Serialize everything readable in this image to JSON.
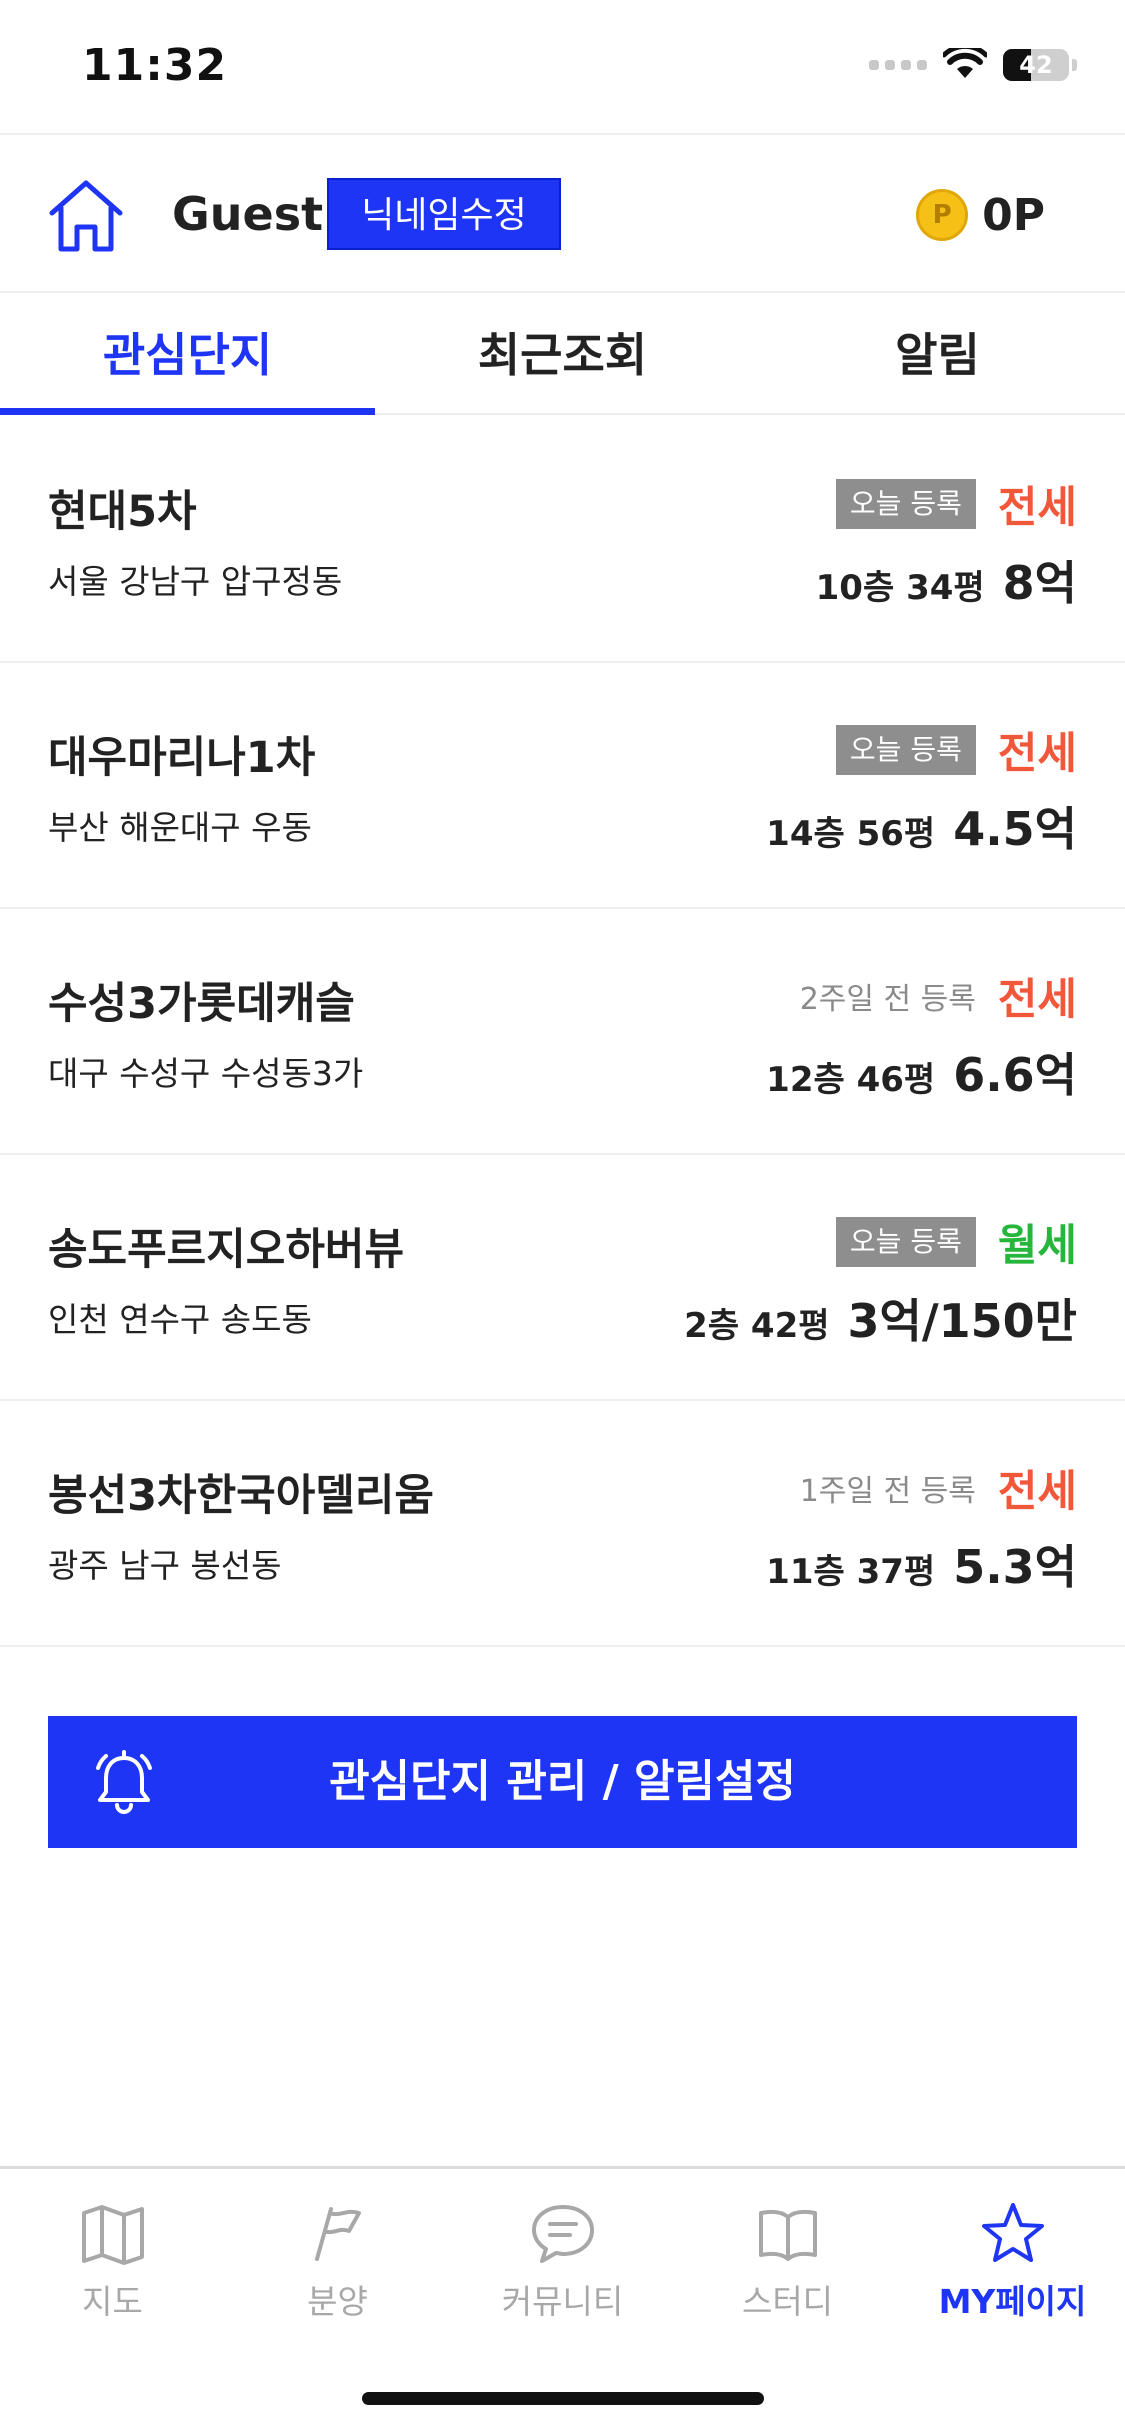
{
  "status_bar": {
    "time": "11:32",
    "battery": "42",
    "battery_level": 0.42
  },
  "profile": {
    "name": "Guest",
    "nickname_button": "닉네임수정",
    "points": "0P",
    "coin_symbol": "P"
  },
  "tabs": [
    {
      "label": "관심단지",
      "active": true
    },
    {
      "label": "최근조회",
      "active": false
    },
    {
      "label": "알림",
      "active": false
    }
  ],
  "items": [
    {
      "name": "현대5차",
      "address": "서울 강남구 압구정동",
      "registered": "오늘 등록",
      "registered_badge": true,
      "deal_type": "전세",
      "deal_kind": "jeonse",
      "floor_size": "10층 34평",
      "price": "8억"
    },
    {
      "name": "대우마리나1차",
      "address": "부산 해운대구 우동",
      "registered": "오늘 등록",
      "registered_badge": true,
      "deal_type": "전세",
      "deal_kind": "jeonse",
      "floor_size": "14층 56평",
      "price": "4.5억"
    },
    {
      "name": "수성3가롯데캐슬",
      "address": "대구 수성구 수성동3가",
      "registered": "2주일 전 등록",
      "registered_badge": false,
      "deal_type": "전세",
      "deal_kind": "jeonse",
      "floor_size": "12층 46평",
      "price": "6.6억"
    },
    {
      "name": "송도푸르지오하버뷰",
      "address": "인천 연수구 송도동",
      "registered": "오늘 등록",
      "registered_badge": true,
      "deal_type": "월세",
      "deal_kind": "wolse",
      "floor_size": "2층 42평",
      "price": "3억/150만"
    },
    {
      "name": "봉선3차한국아델리움",
      "address": "광주 남구 봉선동",
      "registered": "1주일 전 등록",
      "registered_badge": false,
      "deal_type": "전세",
      "deal_kind": "jeonse",
      "floor_size": "11층 37평",
      "price": "5.3억"
    }
  ],
  "manage_button": {
    "label": "관심단지 관리 / 알림설정",
    "icon": "bell-icon"
  },
  "bottom_nav": [
    {
      "label": "지도",
      "icon": "map-icon",
      "active": false
    },
    {
      "label": "분양",
      "icon": "flag-icon",
      "active": false
    },
    {
      "label": "커뮤니티",
      "icon": "chat-icon",
      "active": false
    },
    {
      "label": "스터디",
      "icon": "book-icon",
      "active": false
    },
    {
      "label": "MY페이지",
      "icon": "star-icon",
      "active": true
    }
  ],
  "colors": {
    "accent": "#1f35f5",
    "jeonse": "#f1583a",
    "wolse": "#27b63c",
    "badge": "#8e8e8e",
    "inactive": "#a8a8a8"
  }
}
